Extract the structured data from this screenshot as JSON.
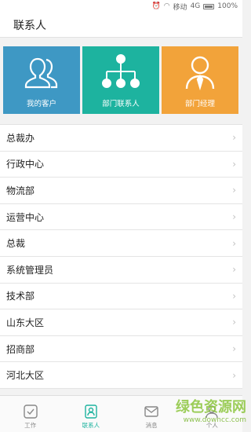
{
  "status": {
    "carrier": "移动",
    "network": "4G",
    "battery": "100%"
  },
  "header": {
    "title": "联系人"
  },
  "tiles": [
    {
      "label": "我的客户",
      "color": "#3e98c4",
      "icon": "customers-icon"
    },
    {
      "label": "部门联系人",
      "color": "#1db39f",
      "icon": "org-chart-icon"
    },
    {
      "label": "部门经理",
      "color": "#f2a33a",
      "icon": "manager-icon"
    }
  ],
  "departments": [
    "总裁办",
    "行政中心",
    "物流部",
    "运营中心",
    "总裁",
    "系统管理员",
    "技术部",
    "山东大区",
    "招商部",
    "河北大区"
  ],
  "tabs": [
    {
      "label": "工作",
      "icon": "work-icon"
    },
    {
      "label": "联系人",
      "icon": "contacts-icon"
    },
    {
      "label": "消息",
      "icon": "message-icon"
    },
    {
      "label": "个人",
      "icon": "person-icon"
    }
  ],
  "watermark": {
    "text": "绿色资源网",
    "url": "www.downcc.com"
  },
  "colors": {
    "accent": "#1db39f",
    "blue": "#3e98c4",
    "orange": "#f2a33a"
  }
}
